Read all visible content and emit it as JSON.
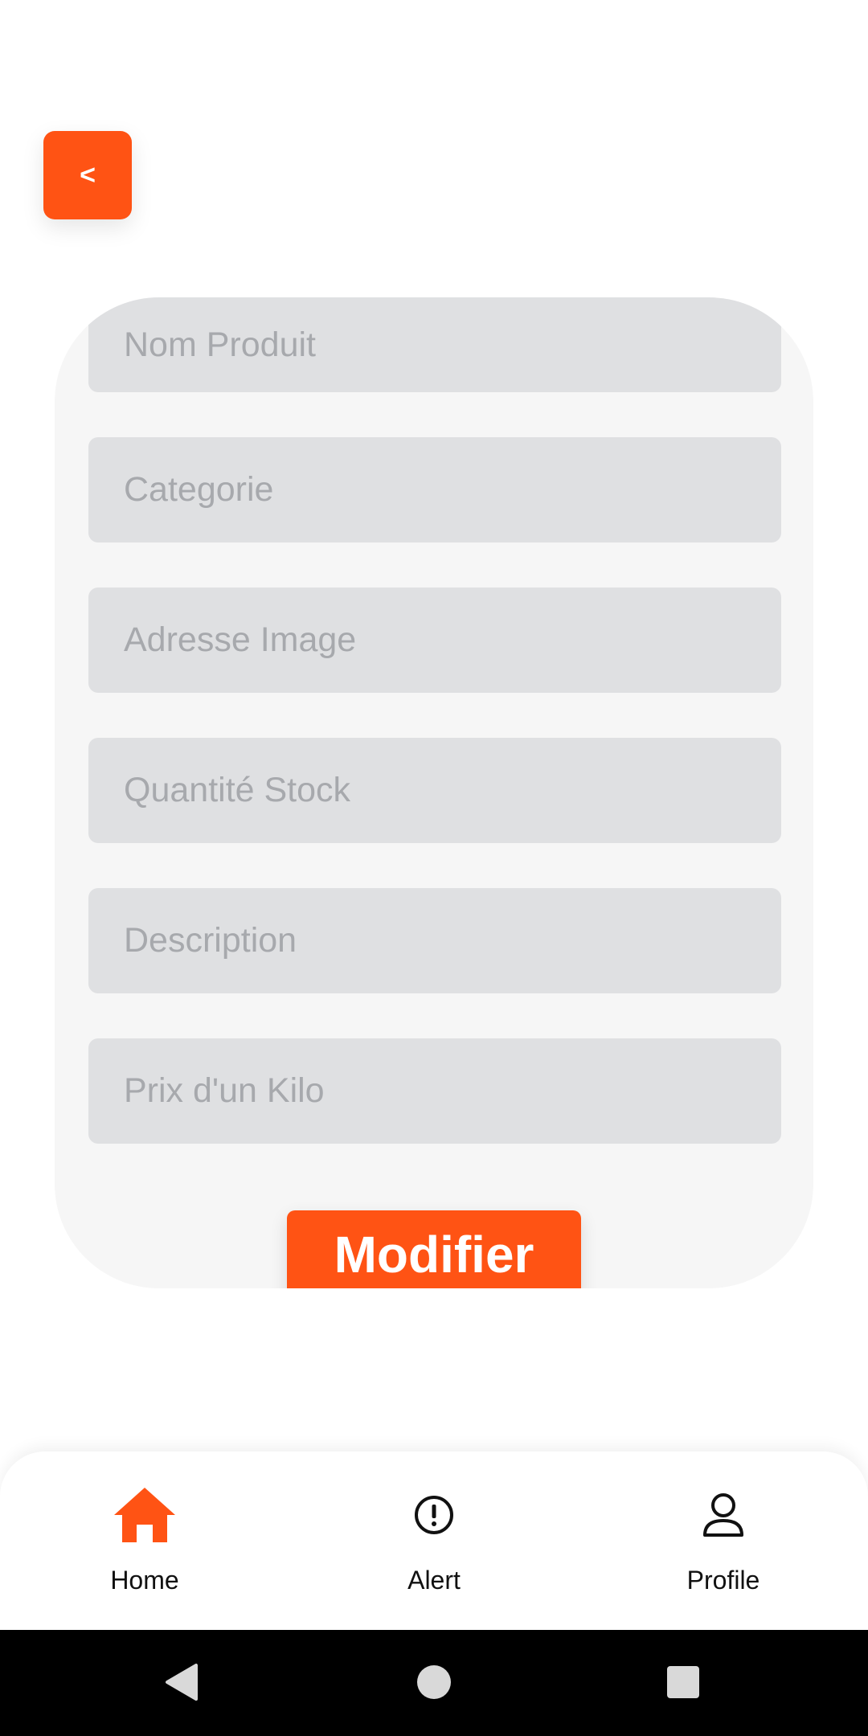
{
  "header": {
    "back_label": "<"
  },
  "form": {
    "fields": [
      {
        "placeholder": "Nom Produit"
      },
      {
        "placeholder": "Categorie"
      },
      {
        "placeholder": "Adresse Image"
      },
      {
        "placeholder": "Quantité Stock"
      },
      {
        "placeholder": "Description"
      },
      {
        "placeholder": "Prix d'un Kilo"
      }
    ],
    "submit_label": "Modifier"
  },
  "bottom_nav": {
    "items": [
      {
        "label": "Home",
        "icon": "home-icon",
        "active": true
      },
      {
        "label": "Alert",
        "icon": "alert-icon",
        "active": false
      },
      {
        "label": "Profile",
        "icon": "profile-icon",
        "active": false
      }
    ]
  },
  "system_nav": {
    "buttons": [
      "back-icon",
      "home-circle-icon",
      "recents-icon"
    ]
  },
  "colors": {
    "accent": "#FF5314",
    "field_bg": "#DFE0E2",
    "card_bg": "#F6F6F6",
    "placeholder": "#A7A9AD"
  }
}
